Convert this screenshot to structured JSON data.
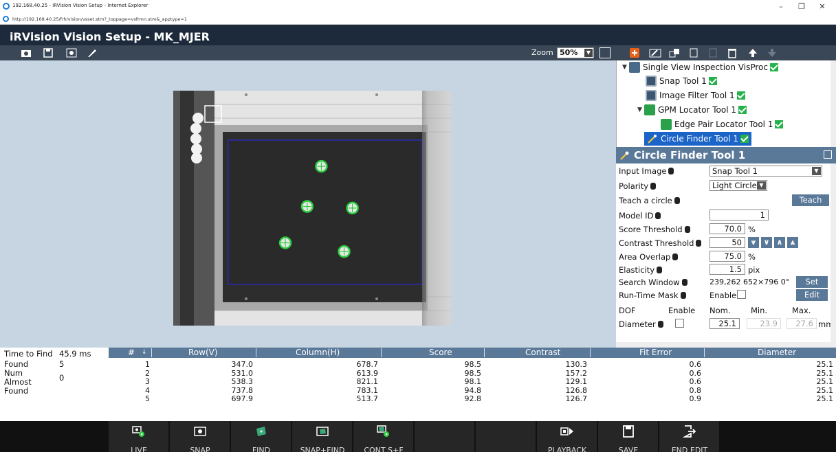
{
  "browser": {
    "window_title": "192.168.40.25 - iRVision Vision Setup - Internet Explorer",
    "url": "http://192.168.40.25/frh/vision/vsset.stm?_toppage=vsfrmn.stm&_apptype=1",
    "minimize": "–",
    "restore": "❐",
    "close": "✕"
  },
  "app": {
    "title": "iRVision Vision Setup - MK_MJER"
  },
  "toolbar": {
    "zoom_label": "Zoom",
    "zoom_value": "50%"
  },
  "tree": {
    "items": [
      {
        "label": "Single View Inspection VisProc",
        "icon": "inspection-icon",
        "checked": true
      },
      {
        "label": "Snap Tool 1",
        "icon": "camera-icon",
        "checked": true
      },
      {
        "label": "Image Filter Tool 1",
        "icon": "filter-icon",
        "checked": true
      },
      {
        "label": "GPM Locator Tool 1",
        "icon": "locator-icon",
        "checked": true
      },
      {
        "label": "Edge Pair Locator Tool 1",
        "icon": "edge-pair-icon",
        "checked": true
      },
      {
        "label": "Circle Finder Tool 1",
        "icon": "circle-finder-icon",
        "checked": true,
        "selected": true
      }
    ]
  },
  "props": {
    "title": "Circle Finder Tool 1",
    "input_image_label": "Input Image",
    "input_image_value": "Snap Tool 1",
    "polarity_label": "Polarity",
    "polarity_value": "Light Circle",
    "teach_label": "Teach a circle",
    "teach_button": "Teach",
    "model_id_label": "Model ID",
    "model_id_value": "1",
    "score_label": "Score Threshold",
    "score_value": "70.0",
    "score_unit": "%",
    "contrast_label": "Contrast Threshold",
    "contrast_value": "50",
    "area_overlap_label": "Area Overlap",
    "area_overlap_value": "75.0",
    "area_overlap_unit": "%",
    "elasticity_label": "Elasticity",
    "elasticity_value": "1.5",
    "elasticity_unit": "pix",
    "search_window_label": "Search Window",
    "search_window_value": "239,262 652×796 0°",
    "set_button": "Set",
    "runtime_mask_label": "Run-Time Mask",
    "runtime_mask_enable": "Enable",
    "edit_button": "Edit",
    "dof_label": "DOF",
    "dof_enable": "Enable",
    "dof_nom": "Nom.",
    "dof_min": "Min.",
    "dof_max": "Max.",
    "diameter_label": "Diameter",
    "diameter_nom": "25.1",
    "diameter_min": "23.9",
    "diameter_max": "27.6",
    "diameter_unit": "mm"
  },
  "results_summary": {
    "time_label": "Time to Find",
    "time_value": "45.9 ms",
    "found_label": "Found",
    "found_value": "5",
    "almost_label": "Num Almost Found",
    "almost_value": "0"
  },
  "results_table": {
    "headers": [
      "#",
      "Row(V)",
      "Column(H)",
      "Score",
      "Contrast",
      "Fit Error",
      "Diameter"
    ],
    "rows": [
      [
        "1",
        "347.0",
        "678.7",
        "98.5",
        "130.3",
        "0.6",
        "25.1"
      ],
      [
        "2",
        "531.0",
        "613.9",
        "98.5",
        "157.2",
        "0.6",
        "25.1"
      ],
      [
        "3",
        "538.3",
        "821.1",
        "98.1",
        "129.1",
        "0.6",
        "25.1"
      ],
      [
        "4",
        "737.8",
        "783.1",
        "94.8",
        "126.8",
        "0.8",
        "25.1"
      ],
      [
        "5",
        "697.9",
        "513.7",
        "92.8",
        "126.7",
        "0.9",
        "25.1"
      ]
    ]
  },
  "actions": {
    "live": "LIVE",
    "snap": "SNAP",
    "find": "FIND",
    "snap_find": "SNAP+FIND",
    "cont": "CONT S+F",
    "playback": "PLAYBACK",
    "save": "SAVE",
    "end_edit": "END EDIT"
  },
  "colors": {
    "header_bg": "#1c2a3b",
    "accent": "#5a7898",
    "found_circle": "#2ecc40",
    "selected": "#1b64c8"
  }
}
